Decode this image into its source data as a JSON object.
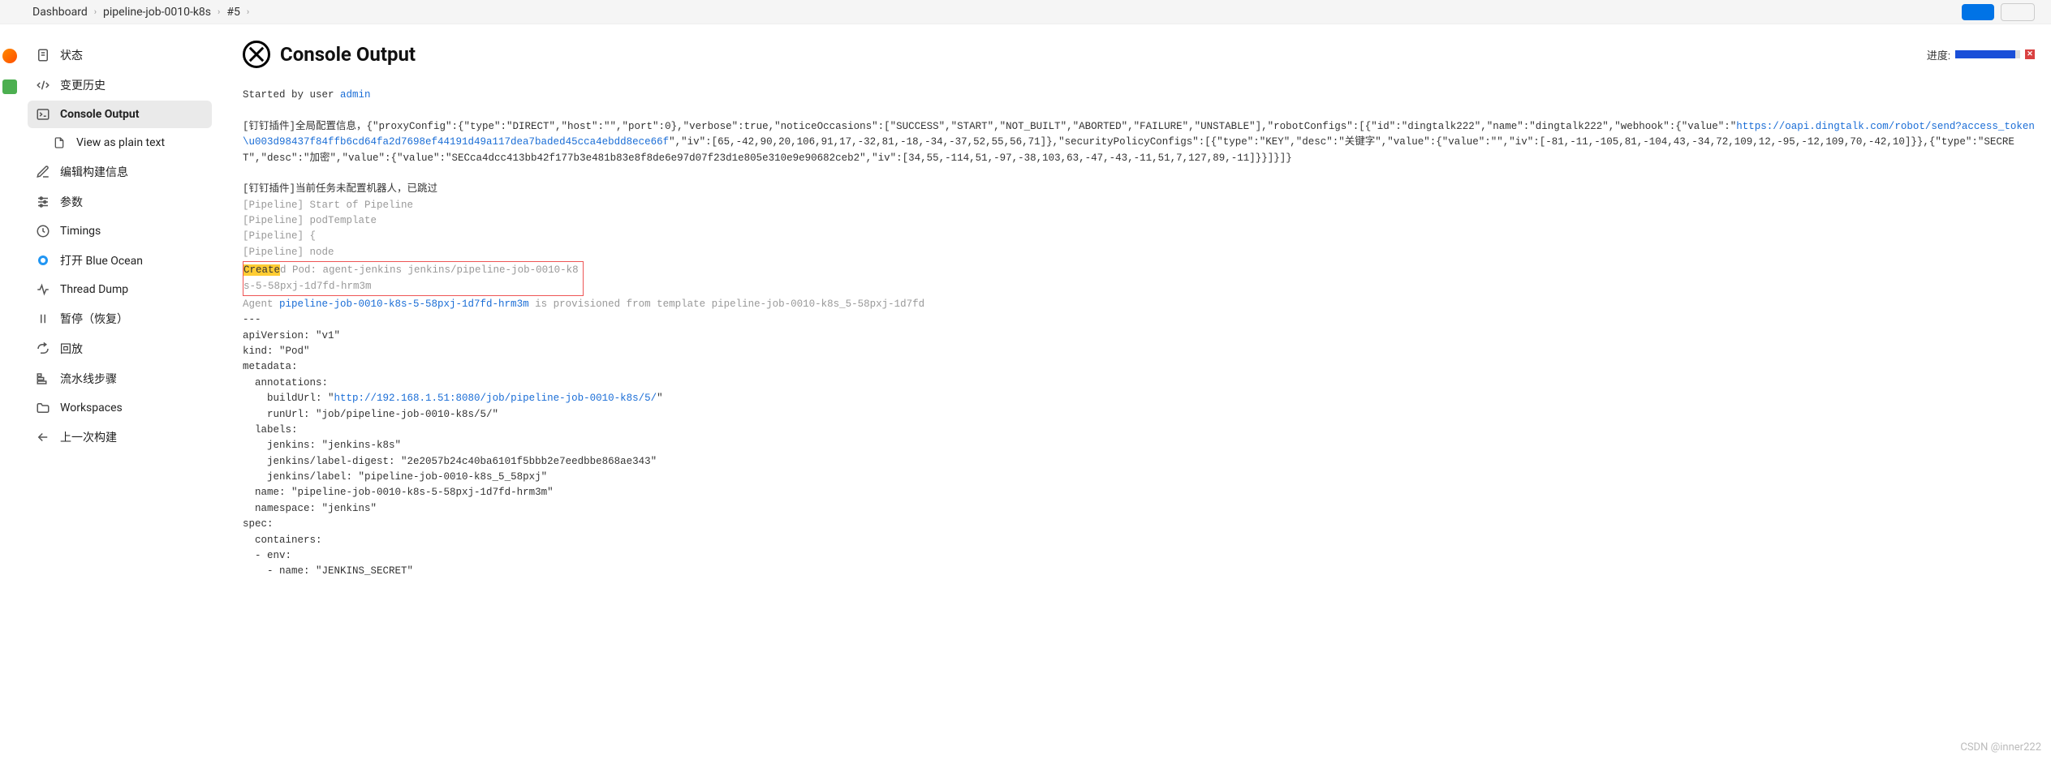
{
  "breadcrumb": {
    "items": [
      "Dashboard",
      "pipeline-job-0010-k8s",
      "#5"
    ]
  },
  "sidebar": {
    "items": [
      {
        "label": "状态",
        "icon": "file-icon"
      },
      {
        "label": "变更历史",
        "icon": "code-icon"
      },
      {
        "label": "Console Output",
        "icon": "terminal-icon",
        "active": true
      },
      {
        "label": "View as plain text",
        "icon": "doc-icon",
        "sub": true
      },
      {
        "label": "编辑构建信息",
        "icon": "edit-icon"
      },
      {
        "label": "参数",
        "icon": "sliders-icon"
      },
      {
        "label": "Timings",
        "icon": "clock-icon"
      },
      {
        "label": "打开 Blue Ocean",
        "icon": "blueocean-icon"
      },
      {
        "label": "Thread Dump",
        "icon": "activity-icon"
      },
      {
        "label": "暂停（恢复）",
        "icon": "pause-icon"
      },
      {
        "label": "回放",
        "icon": "share-icon"
      },
      {
        "label": "流水线步骤",
        "icon": "steps-icon"
      },
      {
        "label": "Workspaces",
        "icon": "folder-icon"
      },
      {
        "label": "上一次构建",
        "icon": "arrow-left-icon"
      }
    ]
  },
  "page": {
    "title": "Console Output",
    "progress_label": "进度:"
  },
  "console": {
    "started_prefix": "Started by user ",
    "started_user": "admin",
    "dingtalk_global_prefix": "[钉钉插件]全局配置信息，{\"proxyConfig\":{\"type\":\"DIRECT\",\"host\":\"\",\"port\":0},\"verbose\":true,\"noticeOccasions\":[\"SUCCESS\",\"START\",\"NOT_BUILT\",\"ABORTED\",\"FAILURE\",\"UNSTABLE\"],\"robotConfigs\":[{\"id\":\"dingtalk222\",\"name\":\"dingtalk222\",\"webhook\":{\"value\":\"",
    "dingtalk_url": "https://oapi.dingtalk.com/robot/send?access_token\\u003d98437f84ffb6cd64fa2d7698ef44191d49a117dea7baded45cca4ebdd8ece66f",
    "dingtalk_global_suffix": "\",\"iv\":[65,-42,90,20,106,91,17,-32,81,-18,-34,-37,52,55,56,71]},\"securityPolicyConfigs\":[{\"type\":\"KEY\",\"desc\":\"关键字\",\"value\":{\"value\":\"\",\"iv\":[-81,-11,-105,81,-104,43,-34,72,109,12,-95,-12,109,70,-42,10]}},{\"type\":\"SECRET\",\"desc\":\"加密\",\"value\":{\"value\":\"SECca4dcc413bb42f177b3e481b83e8f8de6e97d07f23d1e805e310e9e90682ceb2\",\"iv\":[34,55,-114,51,-97,-38,103,63,-47,-43,-11,51,7,127,89,-11]}}]}]}",
    "dingtalk_skip": "[钉钉插件]当前任务未配置机器人，已跳过",
    "pl_start": "[Pipeline] Start of Pipeline",
    "pl_podTemplate": "[Pipeline] podTemplate",
    "pl_brace": "[Pipeline] {",
    "pl_node": "[Pipeline] node",
    "created_hl": "Create",
    "created_rest": "d Pod: agent-jenkins jenkins/pipeline-job-0010-k8s-5-58pxj-1d7fd-hrm3m",
    "agent_prefix": "Agent ",
    "agent_link": "pipeline-job-0010-k8s-5-58pxj-1d7fd-hrm3m",
    "agent_suffix": " is provisioned from template pipeline-job-0010-k8s_5-58pxj-1d7fd",
    "yaml_lines": [
      "---",
      "apiVersion: \"v1\"",
      "kind: \"Pod\"",
      "metadata:",
      "  annotations:"
    ],
    "buildurl_prefix": "    buildUrl: \"",
    "buildurl_link": "http://192.168.1.51:8080/job/pipeline-job-0010-k8s/5/",
    "buildurl_suffix": "\"",
    "yaml_lines2": [
      "    runUrl: \"job/pipeline-job-0010-k8s/5/\"",
      "  labels:",
      "    jenkins: \"jenkins-k8s\"",
      "    jenkins/label-digest: \"2e2057b24c40ba6101f5bbb2e7eedbbe868ae343\"",
      "    jenkins/label: \"pipeline-job-0010-k8s_5_58pxj\"",
      "  name: \"pipeline-job-0010-k8s-5-58pxj-1d7fd-hrm3m\"",
      "  namespace: \"jenkins\"",
      "spec:",
      "  containers:",
      "  - env:",
      "    - name: \"JENKINS_SECRET\""
    ]
  },
  "watermark": "CSDN @inner222"
}
